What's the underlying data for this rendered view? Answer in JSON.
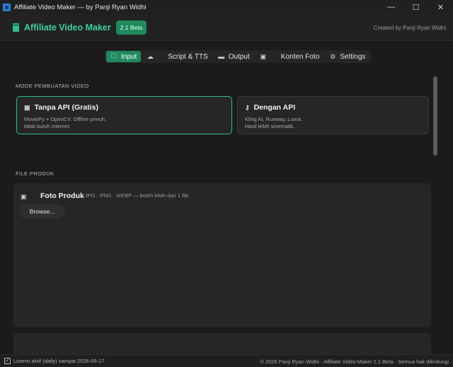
{
  "window": {
    "title": "Affiliate Video Maker — by Panji Ryan Widhi",
    "minimize": "—",
    "maximize": "☐",
    "close": "✕"
  },
  "header": {
    "app_name": "Affiliate Video Maker",
    "version": "2.1 Beta",
    "created_by": "Created by Panji Ryan Widhi"
  },
  "tabs": [
    {
      "label": "Input",
      "icon": "folder-icon",
      "glyph": "🗀"
    },
    {
      "label": "Script & TTS",
      "icon": "cloud-icon",
      "glyph": "☁"
    },
    {
      "label": "Output",
      "icon": "film-icon",
      "glyph": "▬"
    },
    {
      "label": "Konten Foto",
      "icon": "image-icon",
      "glyph": "▣"
    },
    {
      "label": "Settings",
      "icon": "gear-icon",
      "glyph": "⚙"
    }
  ],
  "mode_section": {
    "label": "MODE PEMBUATAN VIDEO",
    "cards": [
      {
        "title": "Tanpa API  (Gratis)",
        "icon": "monitor-icon",
        "glyph": "▣",
        "description": "MoviePy + OpenCV. Offline penuh,\ntidak butuh internet."
      },
      {
        "title": "Dengan API",
        "icon": "key-icon",
        "glyph": "⚷",
        "description": "Kling AI, Runway, Luma.\nHasil lebih sinematik."
      }
    ]
  },
  "file_section": {
    "label": "FILE PRODUK",
    "photo": {
      "title": "Foto Produk",
      "icon": "image-icon",
      "glyph": "▣",
      "hint": "JPG · PNG · WEBP — boleh lebih dari 1 file",
      "browse_label": "Browse..."
    }
  },
  "status": {
    "check_glyph": "✓",
    "license": "Lisensi aktif (daily) sampai 2026-05-17",
    "footer": "© 2026 Panji Ryan Widhi  ·  Affiliate Video Maker 2.1 Beta  ·  Semua hak dilindungi"
  },
  "colors": {
    "accent": "#2ebd8a",
    "accent_dark": "#1f8a5d",
    "background": "#1b1b1b",
    "panel": "#262626"
  }
}
